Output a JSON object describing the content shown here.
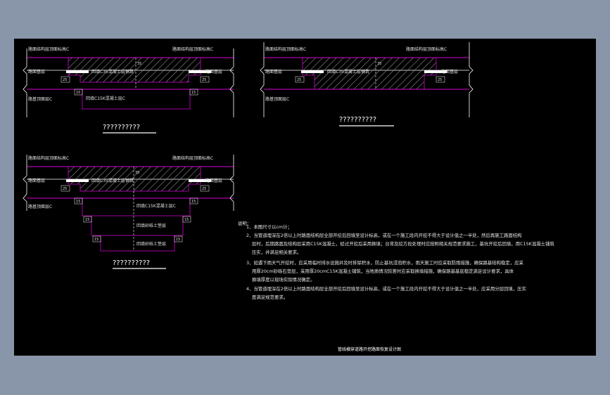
{
  "labels": {
    "top_left": "路面结构层顶面标高C",
    "top_right": "路面结构层顶面标高C",
    "base_left": "路面基层",
    "base_right": "路面基层",
    "subgrade_left": "路基顶面层C",
    "fill_c35": "回填C35混凝土层铺筑",
    "fill_c15": "回填C15K混凝土层C",
    "fill_c15_b": "回填C15K混凝土层C",
    "fill_step2": "回填砂砾土垫层",
    "fill_step3": "回填砂砾土垫层",
    "dim_25": "25",
    "dim_15": "15",
    "dim_35": "35"
  },
  "titles": {
    "fig1": "??????????",
    "fig2": "??????????",
    "fig3": "??????????"
  },
  "notes": {
    "heading": "说明：",
    "n1": "1、本图尺寸以cm计；",
    "n2a": "2、当管道埋深在2倍以上时路面结构层全部开挖后回填至设计标高，或在一个施工段内开挖不得大于设计值之一半处，然后再施工路面结构",
    "n2b": "层时，后期路面及结构层采用C15K混凝土，经过开挖后采用换填；台背及挖方段处理时应按照相关规范要求施工，基坑开挖后回填，用C15K混凝土铺筑",
    "n2c": "压实，并满足相关要求。",
    "n3a": "3、如遇下雨天气开挖时，应采用临时排水设施并及时排除积水，防止基坑浸泡积水，雨天施工时应采取防雨措施，确保路基结构稳定，应采",
    "n3b": "用厚20cm砂砾石垫层，采用厚20cmC15K混凝土铺筑，当地质情况较差时应采取换填措施，确保路基基底稳定满足设计要求，具体",
    "n3c": "换填厚度以现场实际情况确定。",
    "n4a": "4、当管道埋深在2倍以上时路面结构层全部开挖后回填至设计标高，或在一个施工段内开挖不得大于设计值之一半处，应采用分层回填，压实",
    "n4b": "度满足规范要求。"
  },
  "footer": "管线横穿道路开挖路面恢复设计图",
  "colors": {
    "outline": "#d600d6",
    "line": "#ffffff",
    "hatch": "#9a9a9a",
    "background": "#000000",
    "desktop": "#8995a8"
  }
}
